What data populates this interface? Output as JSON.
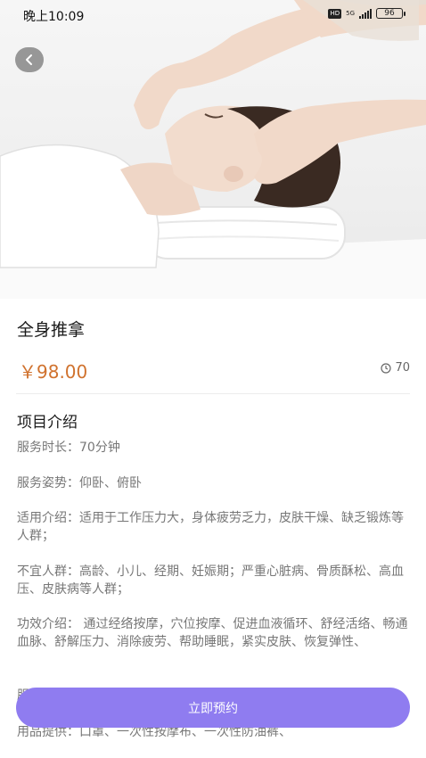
{
  "status_bar": {
    "time": "晚上10:09",
    "hd": "HD",
    "network": "5G",
    "battery": "96"
  },
  "hero": {
    "icon": "massage-photo"
  },
  "product": {
    "title": "全身推拿",
    "price": "￥98.00",
    "sales": "70"
  },
  "section_title": "项目介绍",
  "details": [
    "服务时长：70分钟",
    "服务姿势：仰卧、俯卧",
    "适用介绍：适用于工作压力大，身体疲劳乏力，皮肤干燥、缺乏锻炼等人群；",
    "不宜人群：高龄、小儿、经期、妊娠期；严重心脏病、骨质酥松、高血压、皮肤病等人群；",
    "功效介绍： 通过经络按摩，穴位按摩、促进血液循环、舒经活络、畅通血脉、舒解压力、消除疲劳、帮助睡眠，紧实皮肤、恢复弹性、",
    "服",
    "用品提供：口罩、一次性按摩布、一次性防油裤、"
  ],
  "cta_label": "立即预约",
  "colors": {
    "accent": "#8f7cf0",
    "price": "#d0722e"
  }
}
